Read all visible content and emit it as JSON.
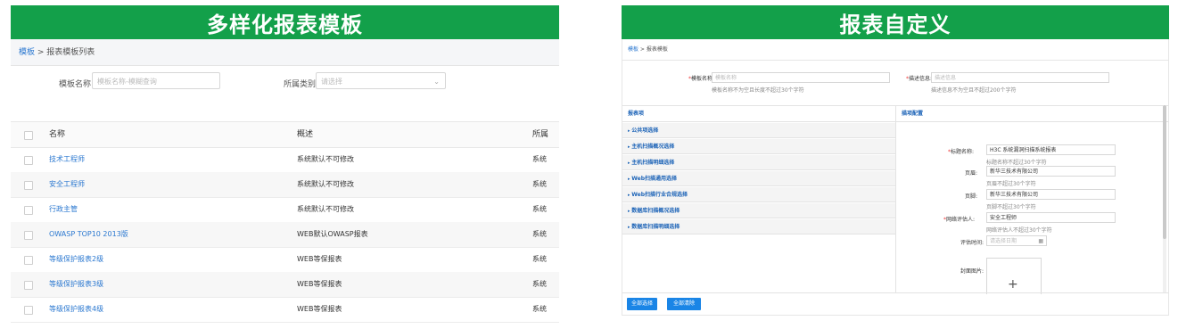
{
  "left": {
    "banner": "多样化报表模板",
    "breadcrumb": {
      "link": "模板",
      "sep": " > ",
      "current": "报表模板列表"
    },
    "filters": {
      "name_label": "模板名称:",
      "name_placeholder": "模板名称-模糊查询",
      "type_label": "所属类别:",
      "type_placeholder": "请选择"
    },
    "table": {
      "headers": [
        "名称",
        "概述",
        "所属"
      ],
      "rows": [
        [
          "技术工程师",
          "系统默认不可修改",
          "系统"
        ],
        [
          "安全工程师",
          "系统默认不可修改",
          "系统"
        ],
        [
          "行政主管",
          "系统默认不可修改",
          "系统"
        ],
        [
          "OWASP TOP10 2013版",
          "WEB默认OWASP报表",
          "系统"
        ],
        [
          "等级保护报表2级",
          "WEB等保报表",
          "系统"
        ],
        [
          "等级保护报表3级",
          "WEB等保报表",
          "系统"
        ],
        [
          "等级保护报表4级",
          "WEB等保报表",
          "系统"
        ]
      ]
    }
  },
  "right": {
    "banner": "报表自定义",
    "breadcrumb": {
      "link": "模板",
      "sep": " > ",
      "current": "报表模板"
    },
    "form": {
      "name_label": "模板名称:",
      "name_placeholder": "模板名称",
      "name_hint": "模板名称不为空且长度不超过30个字符",
      "desc_label": "描述信息:",
      "desc_placeholder": "描述信息",
      "desc_hint": "描述信息不为空且不超过200个字符"
    },
    "items_title": "报表项",
    "config_title": "描项配置",
    "items": [
      "公共项选择",
      "主机扫描概况选择",
      "主机扫描明细选择",
      "Web扫描通用选择",
      "Web扫描行业合规选择",
      "数据库扫描概况选择",
      "数据库扫描明细选择"
    ],
    "config": {
      "title_label": "标题名称:",
      "title_value": "H3C 系统漏洞扫描系统报表",
      "title_hint": "标题名称不超过30个字符",
      "header_label": "页眉:",
      "header_value": "新华三技术有限公司",
      "header_hint": "页眉不超过30个字符",
      "footer_label": "页脚:",
      "footer_value": "新华三技术有限公司",
      "footer_hint": "页脚不超过30个字符",
      "evaluator_label": "网络评估人:",
      "evaluator_value": "安全工程师",
      "evaluator_hint": "网络评估人不超过30个字符",
      "date_label": "评估时间:",
      "date_placeholder": "请选择日期",
      "cover_label": "封面图片:"
    },
    "buttons": {
      "select_all": "全部选择",
      "clear_all": "全部清除"
    }
  }
}
